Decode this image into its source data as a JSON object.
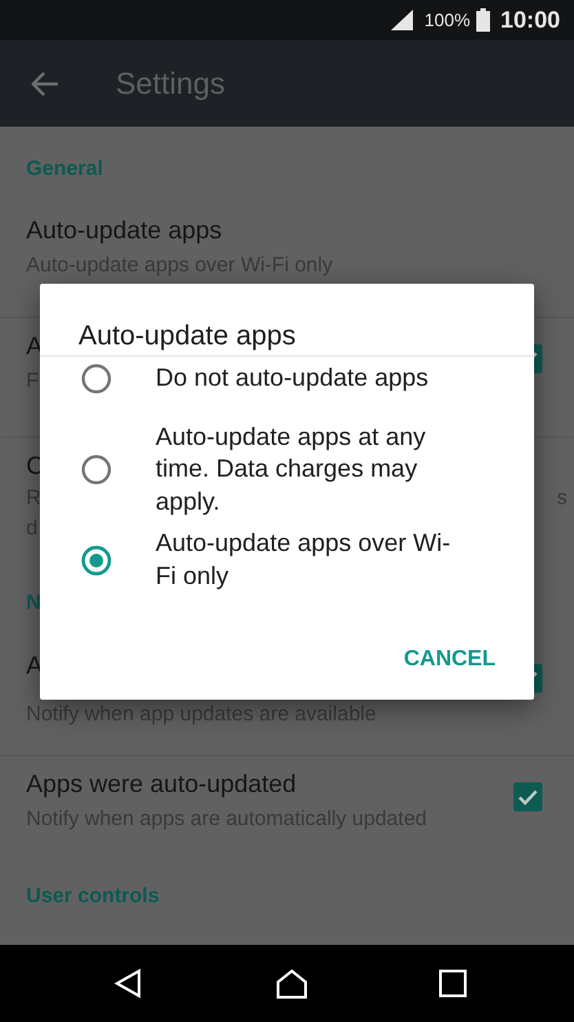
{
  "status_bar": {
    "battery": "100%",
    "time": "10:00"
  },
  "toolbar": {
    "title": "Settings"
  },
  "rows": [
    {
      "kind": "header",
      "title": "General"
    },
    {
      "kind": "setting",
      "title": "Auto-update apps",
      "subtitle_lines": [
        {
          "start": "Auto-update apps over Wi-Fi only"
        }
      ]
    },
    {
      "kind": "setting",
      "title": "A",
      "subtitle_lines": [
        {
          "start": "F"
        }
      ],
      "checked": true
    },
    {
      "kind": "setting",
      "title": "C",
      "subtitle_lines": [
        {
          "start": "R",
          "end": "s"
        },
        {
          "start": "d"
        }
      ]
    },
    {
      "kind": "header",
      "title": "N"
    },
    {
      "kind": "setting",
      "title": "A",
      "subtitle_lines": [
        {
          "start": "Notify when app updates are available"
        }
      ],
      "checked": true
    },
    {
      "kind": "setting",
      "title": "Apps were auto-updated",
      "subtitle_lines": [
        {
          "start": "Notify when apps are automatically updated"
        }
      ],
      "checked": true
    },
    {
      "kind": "header",
      "title": "User controls"
    }
  ],
  "dialog": {
    "title": "Auto-update apps",
    "options": [
      {
        "label": "Do not auto-update apps",
        "selected": false
      },
      {
        "label": "Auto-update apps at any time. Data charges may apply.",
        "selected": false
      },
      {
        "label": "Auto-update apps over Wi-Fi only",
        "selected": true
      }
    ],
    "buttons": [
      "CANCEL"
    ]
  }
}
